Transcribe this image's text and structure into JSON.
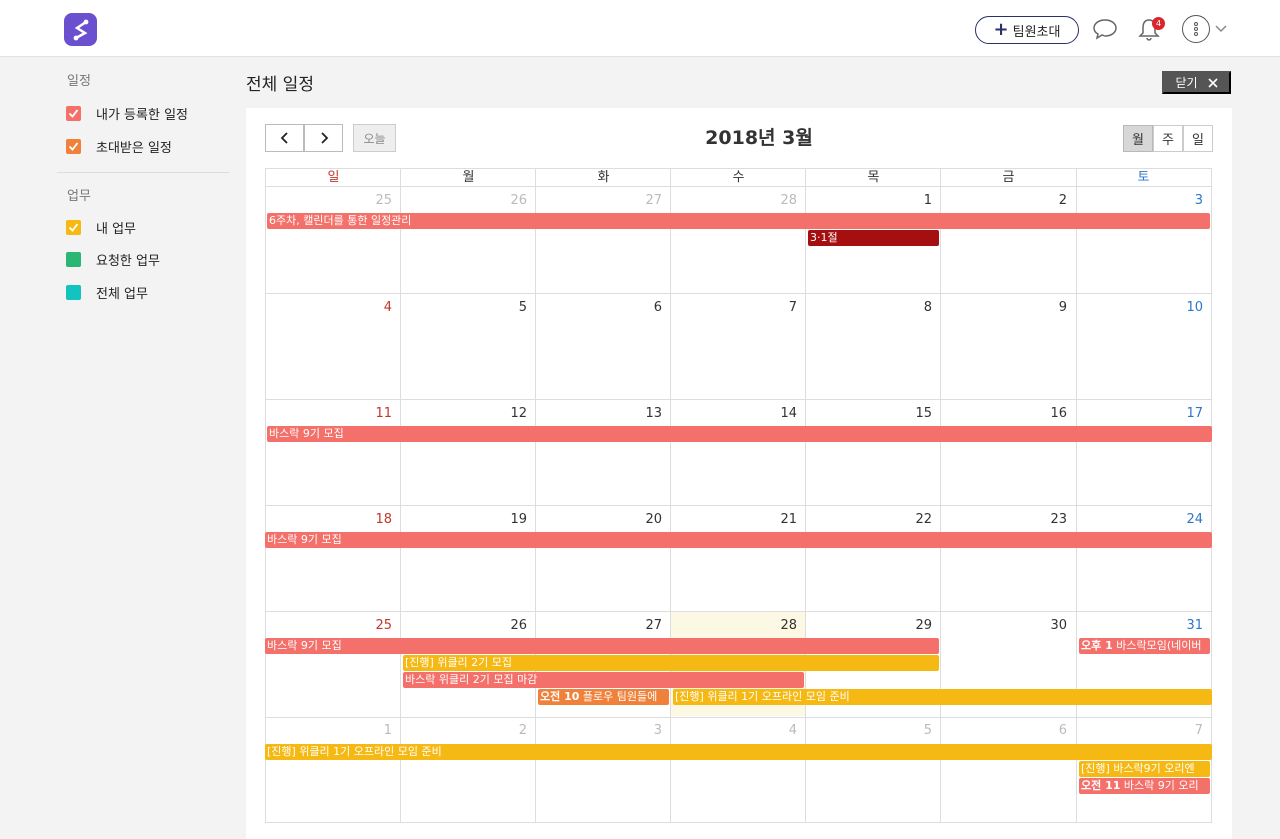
{
  "header": {
    "invite_label": "팀원초대",
    "notification_count": "4"
  },
  "sidebar": {
    "schedule_title": "일정",
    "schedule_items": [
      {
        "label": "내가 등록한 일정",
        "color": "#f3716a"
      },
      {
        "label": "초대받은 일정",
        "color": "#f0813a"
      }
    ],
    "task_title": "업무",
    "task_items": [
      {
        "label": "내 업무",
        "color": "#f6b913"
      },
      {
        "label": "요청한 업무",
        "color": "#2bb673"
      },
      {
        "label": "전체 업무",
        "color": "#12c3c0"
      }
    ]
  },
  "page": {
    "title": "전체 일정",
    "close_label": "닫기"
  },
  "calendar": {
    "title": "2018년 3월",
    "today_label": "오늘",
    "views": [
      "월",
      "주",
      "일"
    ],
    "weekdays": [
      "일",
      "월",
      "화",
      "수",
      "목",
      "금",
      "토"
    ],
    "weeks": [
      [
        "25",
        "26",
        "27",
        "28",
        "1",
        "2",
        "3"
      ],
      [
        "4",
        "5",
        "6",
        "7",
        "8",
        "9",
        "10"
      ],
      [
        "11",
        "12",
        "13",
        "14",
        "15",
        "16",
        "17"
      ],
      [
        "18",
        "19",
        "20",
        "21",
        "22",
        "23",
        "24"
      ],
      [
        "25",
        "26",
        "27",
        "28",
        "29",
        "30",
        "31"
      ],
      [
        "1",
        "2",
        "3",
        "4",
        "5",
        "6",
        "7"
      ]
    ],
    "events": {
      "w1_a": "6주차, 캘린더를 통한 일정관리",
      "w1_b": "3·1절",
      "w3_a": "바스락 9기 모집",
      "w4_a": "바스락 9기 모집",
      "w5_a": "바스락 9기 모집",
      "w5_b": "[진행] 위클리 2기 모집",
      "w5_c": "바스락 위클리 2기 모집 마감",
      "w5_d_time": "오전 10",
      "w5_d": "플로우 팀원들에",
      "w5_e": "[진행] 위클리 1기 오프라인 모임 준비",
      "w5_f_time": "오후 1",
      "w5_f": "바스락모임(네이버",
      "w6_a": "[진행] 위클리 1기 오프라인 모임 준비",
      "w6_b": "[진행] 바스락9기 오리엔",
      "w6_c_time": "오전 11",
      "w6_c": "바스락 9기 오리"
    }
  }
}
